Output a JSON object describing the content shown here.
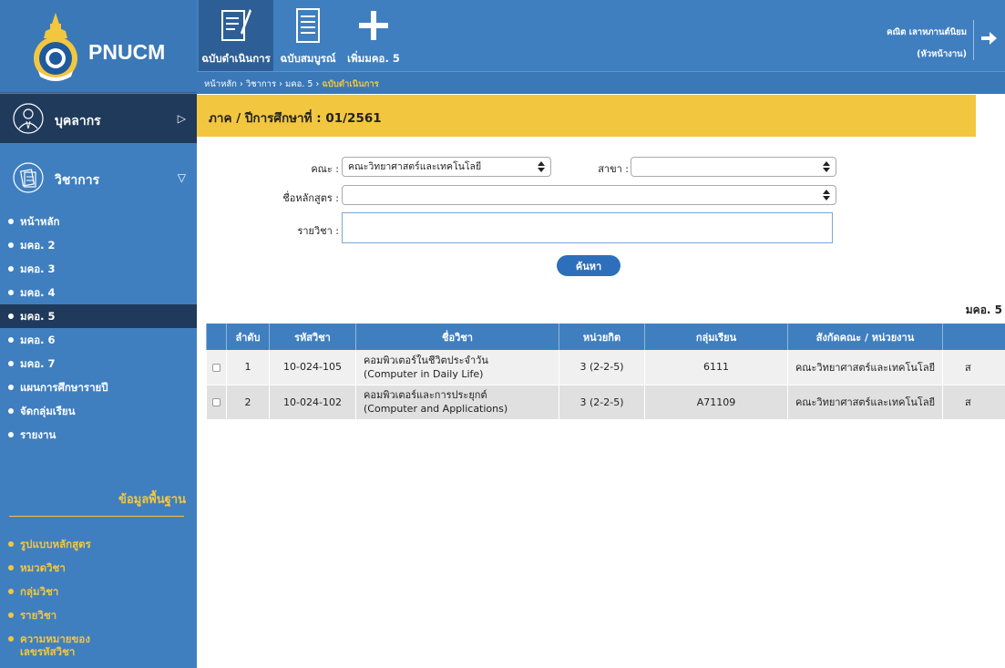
{
  "app": {
    "title": "PNUCM"
  },
  "sidebar": {
    "personnel_label": "บุคลากร",
    "academic_label": "วิชาการ",
    "menu": [
      {
        "label": "หน้าหลัก",
        "active": false
      },
      {
        "label": "มคอ. 2",
        "active": false
      },
      {
        "label": "มคอ. 3",
        "active": false
      },
      {
        "label": "มคอ. 4",
        "active": false
      },
      {
        "label": "มคอ. 5",
        "active": true
      },
      {
        "label": "มคอ. 6",
        "active": false
      },
      {
        "label": "มคอ. 7",
        "active": false
      },
      {
        "label": "แผนการศึกษารายปี",
        "active": false
      },
      {
        "label": "จัดกลุ่มเรียน",
        "active": false
      },
      {
        "label": "รายงาน",
        "active": false
      }
    ],
    "basic_title": "ข้อมูลพื้นฐาน",
    "basic_menu": [
      {
        "label": "รูปแบบหลักสูตร"
      },
      {
        "label": "หมวดวิชา"
      },
      {
        "label": "กลุ่มวิชา"
      },
      {
        "label": "รายวิชา"
      },
      {
        "label": "ความหมายของ\nเลขรหัสวิชา"
      }
    ]
  },
  "toolbar": {
    "in_progress_label": "ฉบับดำเนินการ",
    "complete_label": "ฉบับสมบูรณ์",
    "add_label": "เพิ่มมคอ. 5"
  },
  "breadcrumb": {
    "home": "หน้าหลัก",
    "academic": "วิชาการ",
    "mko5": "มคอ. 5",
    "current": "ฉบับดำเนินการ",
    "sep": "›"
  },
  "user": {
    "name": "คณิต เลาหภานต์นิยม",
    "role": "(หัวหน้างาน)"
  },
  "term": {
    "label": "ภาค / ปีการศึกษาที่ : 01/2561"
  },
  "form": {
    "faculty_label": "คณะ :",
    "faculty_value": "คณะวิทยาศาสตร์และเทคโนโลยี",
    "branch_label": "สาขา :",
    "branch_value": "",
    "curriculum_label": "ชื่อหลักสูตร :",
    "curriculum_value": "",
    "course_label": "รายวิชา :",
    "course_value": "",
    "search_label": "ค้นหา"
  },
  "table_title": "มคอ. 5",
  "table": {
    "headers": [
      "ลำดับ",
      "รหัสวิชา",
      "ชื่อวิชา",
      "หน่วยกิต",
      "กลุ่มเรียน",
      "สังกัดคณะ / หน่วยงาน",
      ""
    ],
    "rows": [
      {
        "no": "1",
        "code": "10-024-105",
        "name_th": "คอมพิวเตอร์ในชีวิตประจำวัน",
        "name_en": "(Computer in Daily Life)",
        "credits": "3 (2-2-5)",
        "group": "6111",
        "faculty": "คณะวิทยาศาสตร์และเทคโนโลยี",
        "extra": "ส"
      },
      {
        "no": "2",
        "code": "10-024-102",
        "name_th": "คอมพิวเตอร์และการประยุกต์",
        "name_en": "(Computer and Applications)",
        "credits": "3 (2-2-5)",
        "group": "A71109",
        "faculty": "คณะวิทยาศาสตร์และเทคโนโลยี",
        "extra": "ส"
      }
    ]
  },
  "colors": {
    "primary": "#3f7fc0",
    "dark": "#1f3a5a",
    "accent": "#f3c640"
  }
}
